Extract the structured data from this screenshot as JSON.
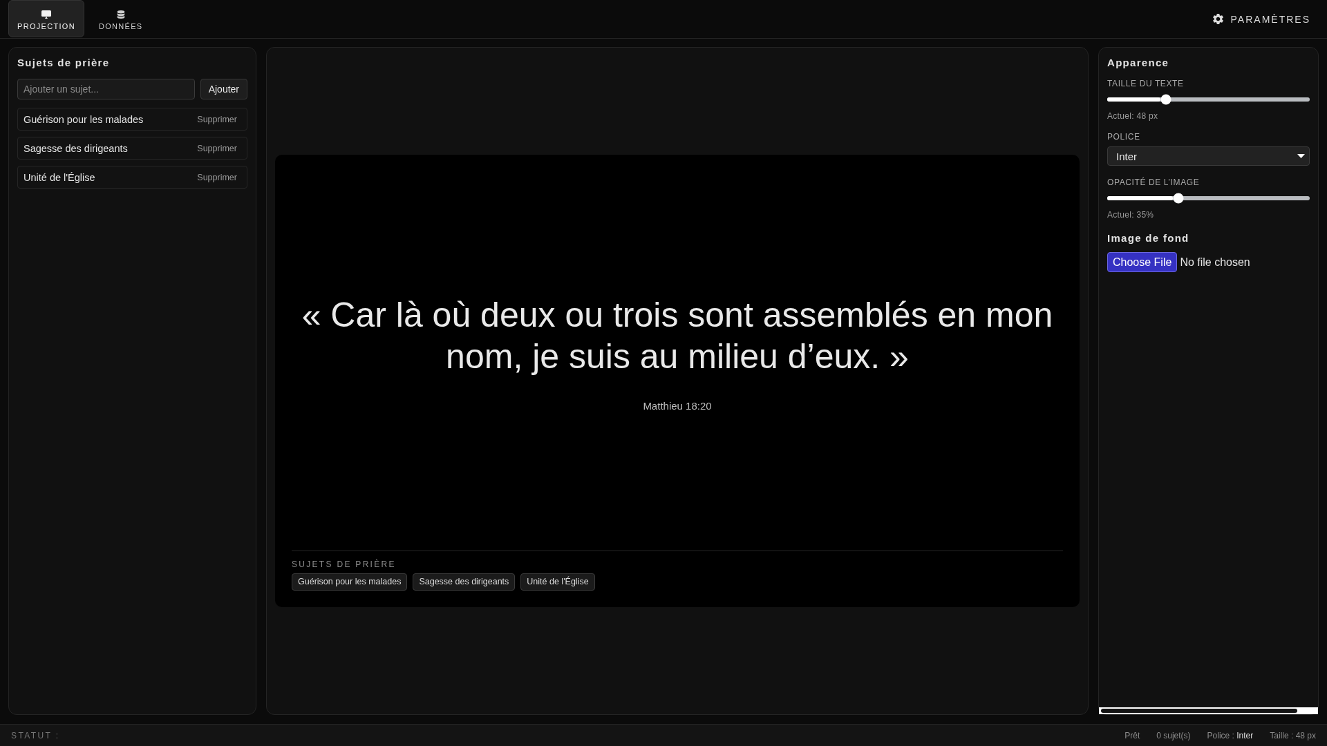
{
  "top_bar": {
    "tabs": [
      {
        "label": "PROJECTION",
        "selected": true
      },
      {
        "label": "DONNÉES",
        "selected": false
      }
    ],
    "settings_button": "PARAMÈTRES"
  },
  "prayer_panel": {
    "title": "Sujets de prière",
    "input": {
      "placeholder": "Ajouter un sujet..."
    },
    "add_button": "Ajouter",
    "subjects": [
      {
        "name": "Guérison pour les malades",
        "remove_button": "Supprimer"
      },
      {
        "name": "Sagesse des dirigeants",
        "remove_button": "Supprimer"
      },
      {
        "name": "Unité de l'Église",
        "remove_button": "Supprimer"
      }
    ]
  },
  "preview": {
    "quote": "« Car là où deux ou trois sont assemblés en mon nom, je suis au milieu d’eux. »",
    "reference": "Matthieu 18:20",
    "topics_heading": "SUJETS DE PRIÈRE",
    "topics": [
      "Guérison pour les malades",
      "Sagesse des dirigeants",
      "Unité de l'Église"
    ]
  },
  "appearance_panel": {
    "title": "Apparence",
    "text_size": {
      "label": "TAILLE DU TEXTE",
      "level": 0.29,
      "reading": "Actuel: 48 px"
    },
    "font": {
      "label": "POLICE",
      "value": "Inter"
    },
    "image_opacity": {
      "label": "OPACITÉ DE L’IMAGE",
      "level": 0.35,
      "reading": "Actuel: 35%"
    },
    "background_image": {
      "title": "Image de fond",
      "button": "Choose File",
      "status": "No file chosen"
    }
  },
  "status_bar": {
    "label": "STATUT :",
    "items": [
      {
        "text": "Prêt"
      },
      {
        "text": "0 sujet(s)"
      },
      {
        "text": "Police :",
        "value": "Inter"
      },
      {
        "text": "Taille : 48 px"
      }
    ]
  }
}
